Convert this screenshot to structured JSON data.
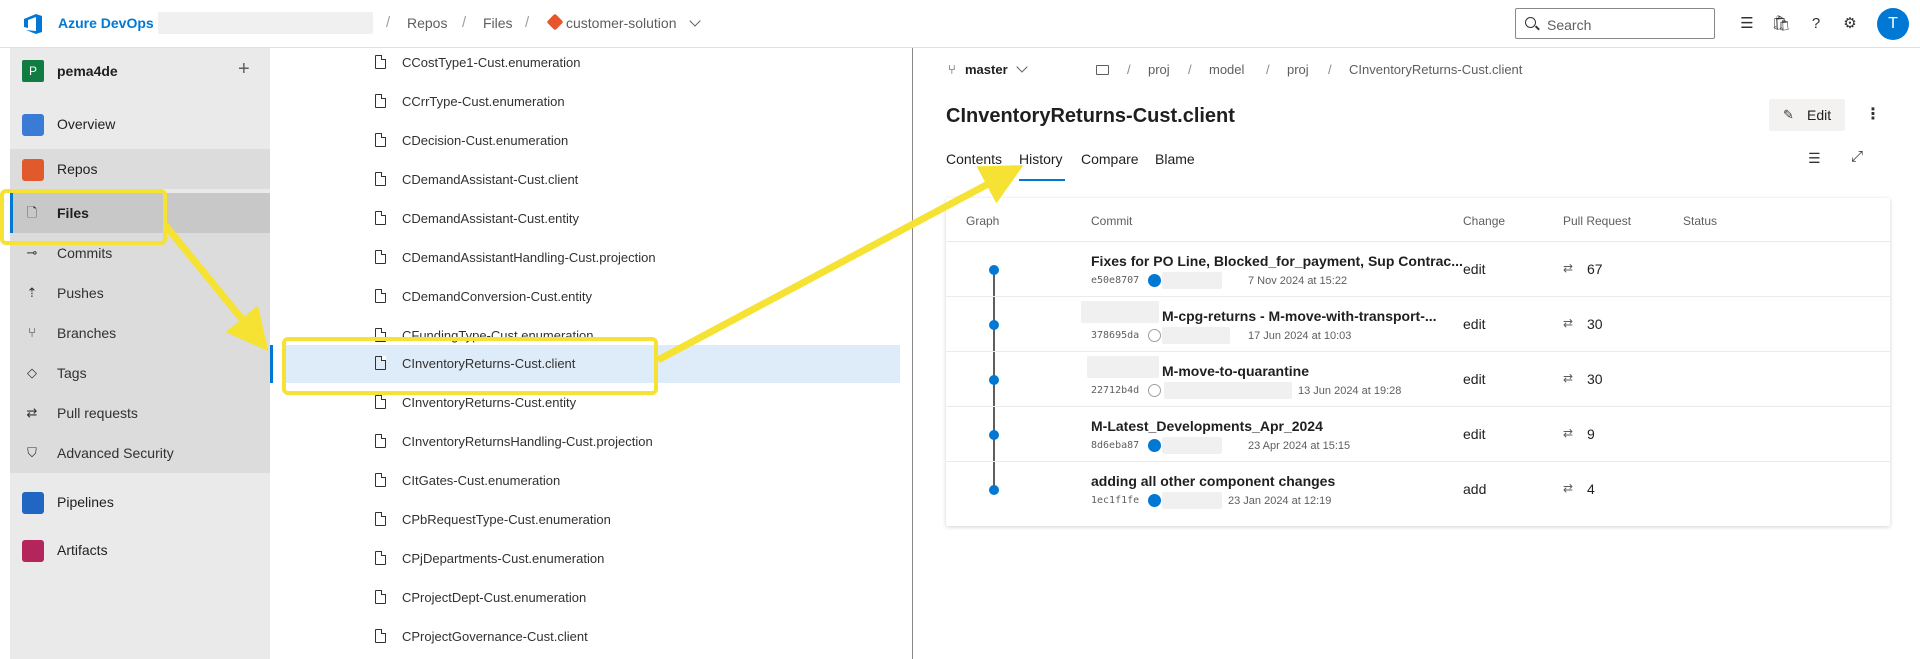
{
  "header": {
    "brand": "Azure DevOps",
    "breadcrumb": [
      "Repos",
      "Files"
    ],
    "repo": "customer-solution",
    "search_placeholder": "Search",
    "avatar_initial": "T"
  },
  "sidebar": {
    "project_initial": "P",
    "project_name": "pema4de",
    "items": [
      {
        "label": "Overview"
      },
      {
        "label": "Repos"
      },
      {
        "label": "Files"
      },
      {
        "label": "Commits"
      },
      {
        "label": "Pushes"
      },
      {
        "label": "Branches"
      },
      {
        "label": "Tags"
      },
      {
        "label": "Pull requests"
      },
      {
        "label": "Advanced Security"
      },
      {
        "label": "Pipelines"
      },
      {
        "label": "Artifacts"
      }
    ],
    "selected": "Files"
  },
  "files": [
    "CCostType1-Cust.enumeration",
    "CCrrType-Cust.enumeration",
    "CDecision-Cust.enumeration",
    "CDemandAssistant-Cust.client",
    "CDemandAssistant-Cust.entity",
    "CDemandAssistantHandling-Cust.projection",
    "CDemandConversion-Cust.entity",
    "CFundingType-Cust.enumeration",
    "CInventoryReturns-Cust.client",
    "CInventoryReturns-Cust.entity",
    "CInventoryReturnsHandling-Cust.projection",
    "CItGates-Cust.enumeration",
    "CPbRequestType-Cust.enumeration",
    "CPjDepartments-Cust.enumeration",
    "CProjectDept-Cust.enumeration",
    "CProjectGovernance-Cust.client"
  ],
  "selected_file": "CInventoryReturns-Cust.client",
  "detail": {
    "branch": "master",
    "path": [
      "proj",
      "model",
      "proj",
      "CInventoryReturns-Cust.client"
    ],
    "title": "CInventoryReturns-Cust.client",
    "edit_label": "Edit",
    "tabs": [
      "Contents",
      "History",
      "Compare",
      "Blame"
    ],
    "active_tab": "History"
  },
  "history": {
    "columns": [
      "Graph",
      "Commit",
      "Change",
      "Pull Request",
      "Status"
    ],
    "rows": [
      {
        "message": "Fixes for PO Line, Blocked_for_payment, Sup Contrac...",
        "sha": "e50e8707",
        "date": "7 Nov 2024 at 15:22",
        "change": "edit",
        "pr": "67"
      },
      {
        "message": "M-cpg-returns - M-move-with-transport-...",
        "sha": "378695da",
        "date": "17 Jun 2024 at 10:03",
        "change": "edit",
        "pr": "30"
      },
      {
        "message": "M-move-to-quarantine",
        "sha": "22712b4d",
        "date": "13 Jun 2024 at 19:28",
        "change": "edit",
        "pr": "30"
      },
      {
        "message": "M-Latest_Developments_Apr_2024",
        "sha": "8d6eba87",
        "date": "23 Apr 2024 at 15:15",
        "change": "edit",
        "pr": "9"
      },
      {
        "message": "adding all other component changes",
        "sha": "1ec1f1fe",
        "date": "23 Jan 2024 at 12:19",
        "change": "add",
        "pr": "4"
      }
    ]
  },
  "colors": {
    "accent": "#0078d4",
    "highlight": "#f5e232",
    "repo_icon": "#e8552b"
  },
  "icons": [
    "azure-devops-logo-icon",
    "folder-icon",
    "file-icon",
    "branch-icon",
    "pencil-icon",
    "pull-request-icon",
    "search-icon"
  ]
}
